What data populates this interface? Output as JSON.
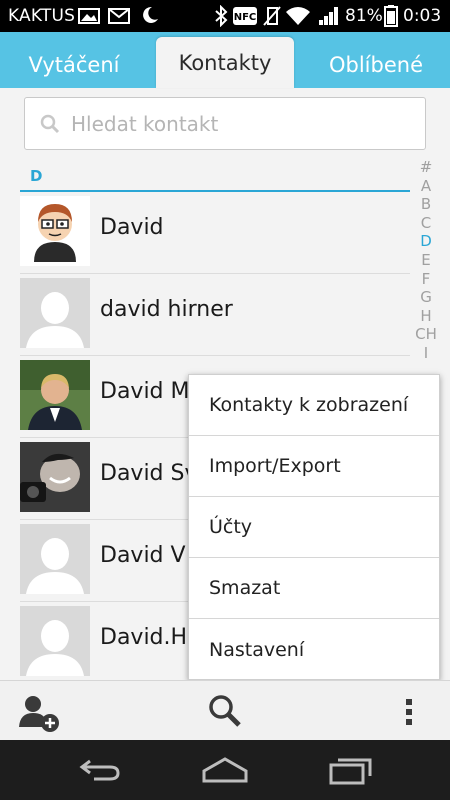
{
  "status_bar": {
    "carrier": "KAKTUS",
    "icons": [
      "image-icon",
      "gmail-icon",
      "moon-icon",
      "bluetooth-icon",
      "nfc-icon",
      "vibrate-icon",
      "wifi-icon",
      "signal-icon",
      "battery-icon"
    ],
    "nfc_label": "NFC",
    "battery": "81%",
    "time": "0:03"
  },
  "tabs": [
    {
      "label": "Vytáčení",
      "active": false
    },
    {
      "label": "Kontakty",
      "active": true
    },
    {
      "label": "Oblíbené",
      "active": false
    }
  ],
  "search": {
    "placeholder": "Hledat kontakt"
  },
  "section": {
    "letter": "D"
  },
  "contacts": [
    {
      "name": "David",
      "avatar": "cartoon"
    },
    {
      "name": "david hirner",
      "avatar": "default"
    },
    {
      "name": "David M",
      "avatar": "photo-suit"
    },
    {
      "name": "David Sv",
      "avatar": "photo-camera"
    },
    {
      "name": "David V",
      "avatar": "default"
    },
    {
      "name": "David.H",
      "avatar": "default"
    }
  ],
  "alphabet_index": [
    "#",
    "A",
    "B",
    "C",
    "D",
    "E",
    "F",
    "G",
    "H",
    "CH",
    "I"
  ],
  "alphabet_selected": "D",
  "menu": {
    "items": [
      "Kontakty k zobrazení",
      "Import/Export",
      "Účty",
      "Smazat",
      "Nastavení"
    ]
  },
  "action_bar": {
    "icons": [
      "add-contact-icon",
      "search-icon",
      "overflow-menu-icon"
    ]
  },
  "nav_bar": {
    "icons": [
      "back-icon",
      "home-icon",
      "recent-apps-icon"
    ]
  },
  "colors": {
    "accent": "#2aa6d5",
    "tabbar": "#56c3e4",
    "background": "#f3f3f3"
  }
}
